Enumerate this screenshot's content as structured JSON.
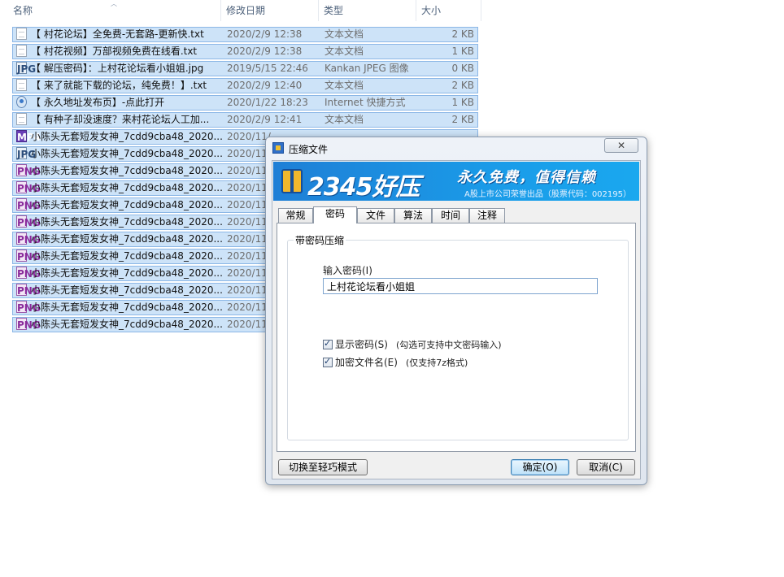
{
  "explorer": {
    "columns": {
      "name": "名称",
      "date": "修改日期",
      "type": "类型",
      "size": "大小"
    },
    "files": [
      {
        "icon": "txt",
        "name": "【 村花论坛】全免费-无套路-更新快.txt",
        "date": "2020/2/9 12:38",
        "type": "文本文档",
        "size": "2 KB"
      },
      {
        "icon": "txt",
        "name": "【 村花视频】万部视频免费在线看.txt",
        "date": "2020/2/9 12:38",
        "type": "文本文档",
        "size": "1 KB"
      },
      {
        "icon": "jpg",
        "name": "【 解压密码】：上村花论坛看小姐姐.jpg",
        "date": "2019/5/15 22:46",
        "type": "Kankan JPEG 图像",
        "size": "0 KB"
      },
      {
        "icon": "txt",
        "name": "【 来了就能下载的论坛，纯免费！】.txt",
        "date": "2020/2/9 12:40",
        "type": "文本文档",
        "size": "2 KB"
      },
      {
        "icon": "url",
        "name": "【 永久地址发布页】-点此打开",
        "date": "2020/1/22 18:23",
        "type": "Internet 快捷方式",
        "size": "1 KB"
      },
      {
        "icon": "txt",
        "name": "【 有种子却没速度？来村花论坛人工加...",
        "date": "2020/2/9 12:41",
        "type": "文本文档",
        "size": "2 KB"
      },
      {
        "icon": "mp4",
        "name": "小陈头无套短发女神_7cdd9cba48_2020...",
        "date": "2020/11/",
        "type": "",
        "size": ""
      },
      {
        "icon": "jpg",
        "name": "小陈头无套短发女神_7cdd9cba48_2020...",
        "date": "2020/11/",
        "type": "",
        "size": ""
      },
      {
        "icon": "png",
        "name": "小陈头无套短发女神_7cdd9cba48_2020...",
        "date": "2020/11/",
        "type": "",
        "size": ""
      },
      {
        "icon": "png",
        "name": "小陈头无套短发女神_7cdd9cba48_2020...",
        "date": "2020/11/",
        "type": "",
        "size": ""
      },
      {
        "icon": "png",
        "name": "小陈头无套短发女神_7cdd9cba48_2020...",
        "date": "2020/11/",
        "type": "",
        "size": ""
      },
      {
        "icon": "png",
        "name": "小陈头无套短发女神_7cdd9cba48_2020...",
        "date": "2020/11/",
        "type": "",
        "size": ""
      },
      {
        "icon": "png",
        "name": "小陈头无套短发女神_7cdd9cba48_2020...",
        "date": "2020/11/",
        "type": "",
        "size": ""
      },
      {
        "icon": "png",
        "name": "小陈头无套短发女神_7cdd9cba48_2020...",
        "date": "2020/11/",
        "type": "",
        "size": ""
      },
      {
        "icon": "png",
        "name": "小陈头无套短发女神_7cdd9cba48_2020...",
        "date": "2020/11/",
        "type": "",
        "size": ""
      },
      {
        "icon": "png",
        "name": "小陈头无套短发女神_7cdd9cba48_2020...",
        "date": "2020/11/",
        "type": "",
        "size": ""
      },
      {
        "icon": "png",
        "name": "小陈头无套短发女神_7cdd9cba48_2020...",
        "date": "2020/11/",
        "type": "",
        "size": ""
      },
      {
        "icon": "png",
        "name": "小陈头无套短发女神_7cdd9cba48_2020...",
        "date": "2020/11/",
        "type": "",
        "size": ""
      }
    ]
  },
  "dialog": {
    "title": "压缩文件",
    "close": "✕",
    "banner": {
      "name": "2345好压",
      "slogan": "永久免费，值得信赖",
      "sub": "A股上市公司荣誉出品（股票代码：002195）"
    },
    "tabs": [
      "常规",
      "密码",
      "文件",
      "算法",
      "时间",
      "注释"
    ],
    "active_tab": "密码",
    "group_title": "带密码压缩",
    "password_label": "输入密码(I)",
    "password_value": "上村花论坛看小姐姐",
    "show_password": {
      "label": "显示密码(S)",
      "note": "(勾选可支持中文密码输入)",
      "checked": true
    },
    "encrypt_names": {
      "label": "加密文件名(E)",
      "note": "(仅支持7z格式)",
      "checked": true
    },
    "buttons": {
      "switch": "切换至轻巧模式",
      "ok": "确定(O)",
      "cancel": "取消(C)"
    }
  }
}
